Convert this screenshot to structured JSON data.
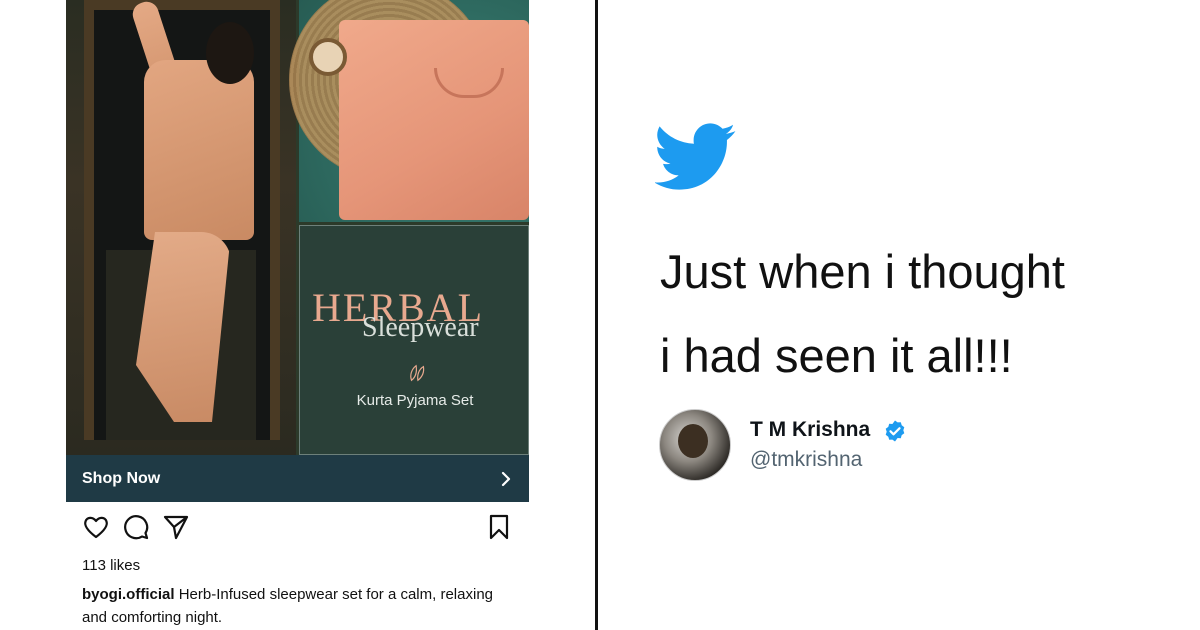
{
  "instagram_post": {
    "image_text": {
      "brand_word": "HERBAL",
      "brand_sub": "Sleepwear",
      "product": "Kurta Pyjama Set"
    },
    "shop_button": {
      "label": "Shop Now",
      "icon": "chevron-right-icon"
    },
    "actions": {
      "like_icon": "heart-icon",
      "comment_icon": "comment-icon",
      "share_icon": "send-icon",
      "save_icon": "bookmark-icon"
    },
    "likes": "113 likes",
    "caption": {
      "username": "byogi.official",
      "text": "Herb-Infused sleepwear set for a calm, relaxing and comforting night."
    }
  },
  "tweet": {
    "logo_icon": "twitter-bird-icon",
    "text_line1": "Just when i thought",
    "text_line2": "i had seen it all!!!",
    "author": {
      "name": "T M Krishna",
      "handle": "@tmkrishna",
      "verified": true
    }
  },
  "colors": {
    "twitter_blue": "#1d9bf0",
    "shop_bar": "#1f3a45",
    "brand_panel": "#2a4038",
    "herbal_peach": "#e8a98f",
    "handle_gray": "#536471"
  }
}
